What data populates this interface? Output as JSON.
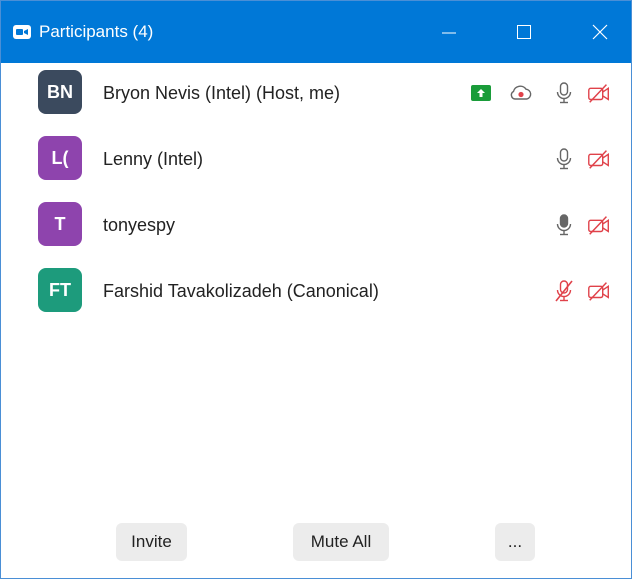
{
  "window": {
    "title": "Participants (4)",
    "accent_color": "#0078d7"
  },
  "participants": [
    {
      "initials": "BN",
      "name": "Bryon Nevis (Intel) (Host, me)",
      "avatar_color": "#3b4a5e",
      "sharing_icon": "upload-share-icon",
      "recording_icon": "cloud-record-icon",
      "mic": "on",
      "video": "off"
    },
    {
      "initials": "L(",
      "name": "Lenny (Intel)",
      "avatar_color": "#8e44ad",
      "mic": "on",
      "video": "off"
    },
    {
      "initials": "T",
      "name": "tonyespy",
      "avatar_color": "#8e44ad",
      "mic": "active",
      "video": "off"
    },
    {
      "initials": "FT",
      "name": "Farshid Tavakolizadeh (Canonical)",
      "avatar_color": "#1d9b7c",
      "mic": "muted",
      "video": "off"
    }
  ],
  "footer": {
    "invite_label": "Invite",
    "mute_all_label": "Mute All",
    "more_label": "..."
  },
  "colors": {
    "muted_red": "#e0424a",
    "share_green": "#1a9c3a",
    "icon_gray": "#666666"
  }
}
